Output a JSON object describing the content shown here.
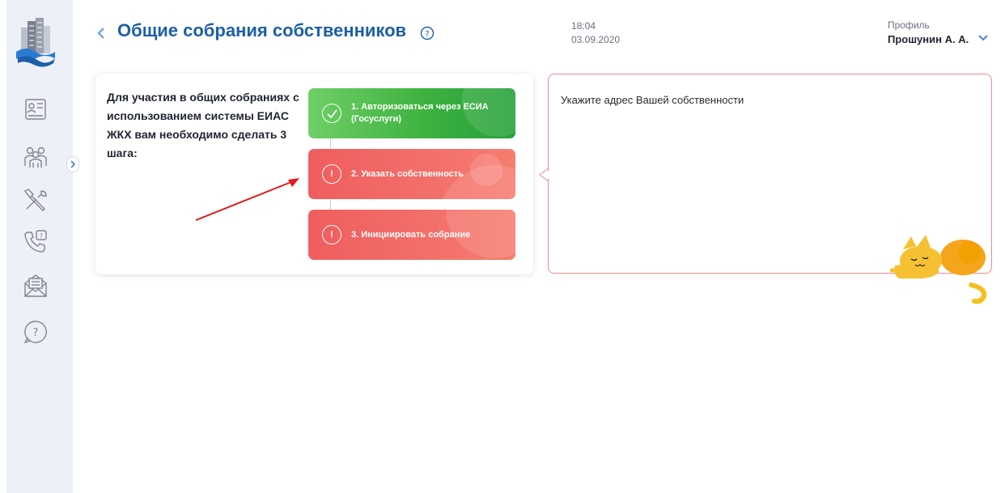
{
  "header": {
    "title": "Общие собрания собственников",
    "time": "18:04",
    "date": "03.09.2020",
    "profile_label": "Профиль",
    "profile_name": "Прошунин А. А."
  },
  "sidebar": {
    "items": [
      {
        "icon": "id-card-icon"
      },
      {
        "icon": "people-icon"
      },
      {
        "icon": "tools-icon"
      },
      {
        "icon": "phone-icon"
      },
      {
        "icon": "mail-icon"
      },
      {
        "icon": "help-icon"
      }
    ]
  },
  "steps": {
    "intro": "Для участия в общих собраниях с использованием системы ЕИАС ЖКХ вам необходимо сделать 3 шага:",
    "items": [
      {
        "label": "1. Авторизоваться через ЕСИА (Госуслуги)",
        "status": "done",
        "mark": ""
      },
      {
        "label": "2. Указать собственность",
        "status": "todo",
        "mark": "!"
      },
      {
        "label": "3. Инициировать собрание",
        "status": "todo",
        "mark": "!"
      }
    ]
  },
  "address": {
    "label": "Укажите адрес Вашей собственности"
  },
  "colors": {
    "accent": "#1d5fa8",
    "done": "#3fb240",
    "todo": "#f06a66",
    "sidebar_bg": "#eef0f8"
  }
}
